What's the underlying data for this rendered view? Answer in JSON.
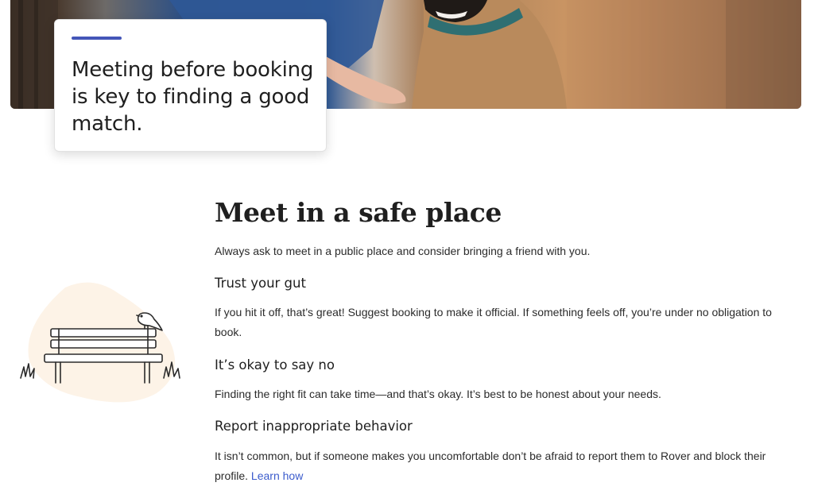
{
  "hero": {
    "callout_text": "Meeting before booking is key to finding a good match."
  },
  "section": {
    "title": "Meet in a safe place",
    "intro": "Always ask to meet in a public place and consider bringing a friend with you.",
    "items": [
      {
        "heading": "Trust your gut",
        "text": "If you hit it off, that’s great! Suggest booking to make it official. If something feels off, you’re under no obligation to book."
      },
      {
        "heading": "It’s okay to say no",
        "text": "Finding the right fit can take time—and that’s okay. It’s best to be honest about your needs."
      },
      {
        "heading": "Report inappropriate behavior",
        "text": "It isn’t common, but if someone makes you uncomfortable don’t be afraid to report them to Rover and block their profile.",
        "link_label": "Learn how"
      }
    ]
  },
  "illustration": {
    "icon": "park-bench-with-bird-icon"
  },
  "colors": {
    "accent": "#4456b8",
    "link": "#3b5bcc",
    "illustration_blob": "#fdf3e7"
  }
}
